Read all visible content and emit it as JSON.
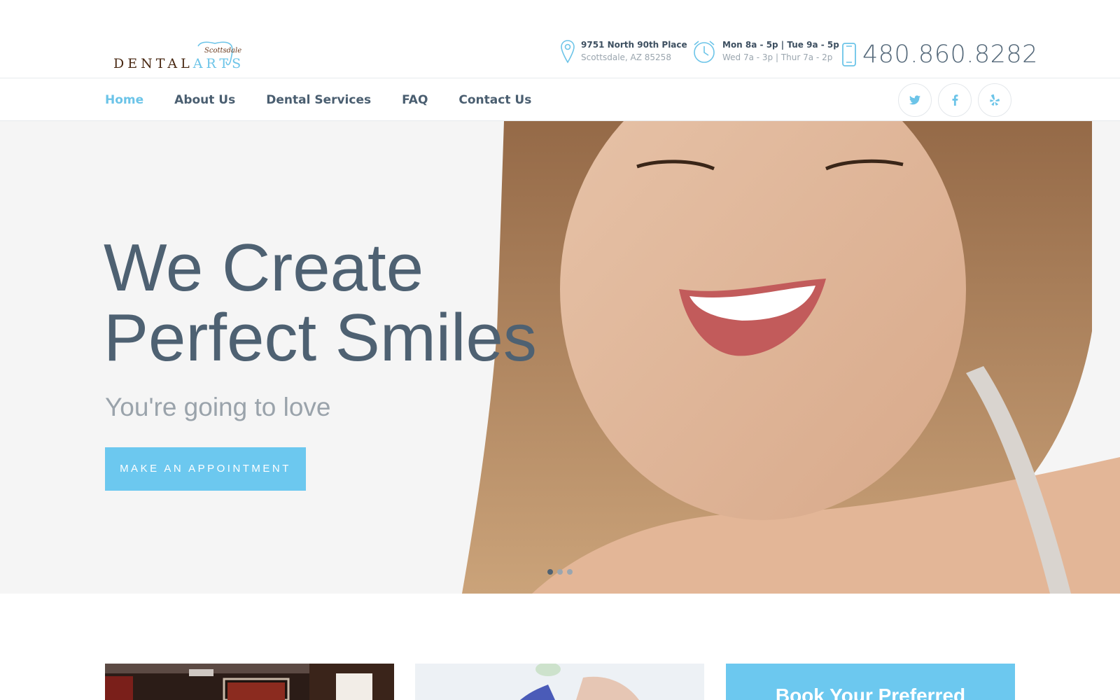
{
  "brand": {
    "logo_top": "Scottsdale",
    "logo_word_1": "DENTAL",
    "logo_word_2": "ARTS"
  },
  "contact": {
    "address_line1": "9751 North 90th Place",
    "address_line2": "Scottsdale, AZ 85258",
    "hours_line1": "Mon 8a - 5p | Tue 9a - 5p",
    "hours_line2": "Wed 7a - 3p | Thur 7a - 2p",
    "phone": "480.860.8282"
  },
  "nav": {
    "items": [
      {
        "label": "Home",
        "active": true
      },
      {
        "label": "About Us",
        "active": false
      },
      {
        "label": "Dental Services",
        "active": false
      },
      {
        "label": "FAQ",
        "active": false
      },
      {
        "label": "Contact Us",
        "active": false
      }
    ],
    "social": [
      "twitter-icon",
      "facebook-icon",
      "yelp-icon"
    ]
  },
  "hero": {
    "title_line1": "We Create",
    "title_line2": "Perfect Smiles",
    "subtitle": "You're going to love",
    "cta_label": "MAKE AN APPOINTMENT",
    "slide_count": 3,
    "active_slide": 1
  },
  "cards": {
    "card3_title": "Book Your Preferred"
  },
  "colors": {
    "accent": "#6cc8ef",
    "text": "#4e6172",
    "muted": "#9aa5ae"
  }
}
